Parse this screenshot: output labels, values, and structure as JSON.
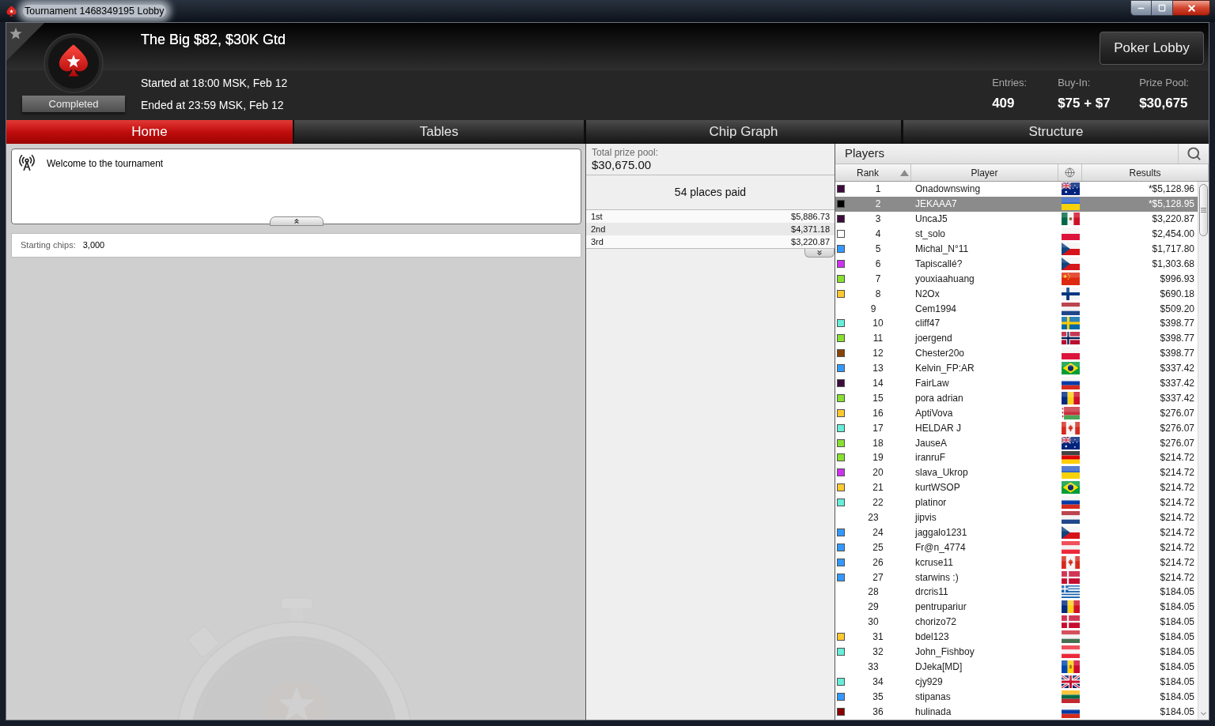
{
  "window": {
    "title": "Tournament 1468349195 Lobby"
  },
  "header": {
    "title": "The Big $82, $30K Gtd",
    "status": "Completed",
    "started": "Started at 18:00 MSK, Feb 12",
    "ended": "Ended at 23:59 MSK, Feb 12",
    "lobby_button": "Poker Lobby",
    "stats": [
      {
        "label": "Entries:",
        "value": "409"
      },
      {
        "label": "Buy-In:",
        "value": "$75 + $7"
      },
      {
        "label": "Prize Pool:",
        "value": "$30,675"
      }
    ]
  },
  "tabs": [
    {
      "label": "Home",
      "selected": true
    },
    {
      "label": "Tables",
      "selected": false
    },
    {
      "label": "Chip Graph",
      "selected": false
    },
    {
      "label": "Structure",
      "selected": false
    }
  ],
  "home": {
    "message": "Welcome to the tournament",
    "starting_chips": {
      "label": "Starting chips:",
      "value": "3,000"
    }
  },
  "prizes": {
    "total_label": "Total prize pool:",
    "total": "$30,675.00",
    "places_paid": "54 places paid",
    "rows": [
      {
        "place": "1st",
        "amount": "$5,886.73"
      },
      {
        "place": "2nd",
        "amount": "$4,371.18"
      },
      {
        "place": "3rd",
        "amount": "$3,220.87"
      }
    ]
  },
  "players": {
    "title": "Players",
    "columns": [
      {
        "kind": "text",
        "label": "Rank",
        "sorted": true
      },
      {
        "kind": "text",
        "label": "Player",
        "sorted": false
      },
      {
        "kind": "icon",
        "sorted": false
      },
      {
        "kind": "text",
        "label": "Results",
        "sorted": false
      }
    ],
    "rows": [
      {
        "rank": "1",
        "name": "Onadownswing",
        "kind": "australia",
        "result": "*$5,128.96",
        "color": "#3d0c3d",
        "selected": false
      },
      {
        "rank": "2",
        "name": "JEKAAA7",
        "kind": "ukraine",
        "result": "*$5,128.95",
        "color": "#000000",
        "selected": true
      },
      {
        "rank": "3",
        "name": "UncaJ5",
        "kind": "mexico",
        "result": "$3,220.87",
        "color": "#3d0c3d",
        "selected": false
      },
      {
        "rank": "4",
        "name": "st_solo",
        "kind": "poland",
        "result": "$2,454.00",
        "color": "#ffffff",
        "selected": false
      },
      {
        "rank": "5",
        "name": "Michal_N°11",
        "kind": "czechia",
        "result": "$1,717.80",
        "color": "#3399ff",
        "selected": false
      },
      {
        "rank": "6",
        "name": "Tapiscallé?",
        "kind": "czechia",
        "result": "$1,303.68",
        "color": "#cc33ee",
        "selected": false
      },
      {
        "rank": "7",
        "name": "youxiaahuang",
        "kind": "china",
        "result": "$996.93",
        "color": "#88e030",
        "selected": false
      },
      {
        "rank": "8",
        "name": "N2Ox",
        "kind": "finland",
        "result": "$690.18",
        "color": "#ffc82e",
        "selected": false
      },
      {
        "rank": "9",
        "name": "Cem1994",
        "kind": "netherlands",
        "result": "$509.20",
        "selected": false
      },
      {
        "rank": "10",
        "name": "cliff47",
        "kind": "sweden",
        "result": "$398.77",
        "color": "#66eed8",
        "selected": false
      },
      {
        "rank": "11",
        "name": "joergend",
        "kind": "norway",
        "result": "$398.77",
        "color": "#88e030",
        "selected": false
      },
      {
        "rank": "12",
        "name": "Chester20o",
        "kind": "poland",
        "result": "$398.77",
        "color": "#884408",
        "selected": false
      },
      {
        "rank": "13",
        "name": "Kelvin_FP:AR",
        "kind": "brazil",
        "result": "$337.42",
        "color": "#3399ff",
        "selected": false
      },
      {
        "rank": "14",
        "name": "FairLaw",
        "kind": "russia",
        "result": "$337.42",
        "color": "#3d0c3d",
        "selected": false
      },
      {
        "rank": "15",
        "name": "pora adrian",
        "kind": "romania",
        "result": "$337.42",
        "color": "#88e030",
        "selected": false
      },
      {
        "rank": "16",
        "name": "AptiVova",
        "kind": "belarus",
        "result": "$276.07",
        "color": "#ffc82e",
        "selected": false
      },
      {
        "rank": "17",
        "name": "HELDAR J",
        "kind": "canada",
        "result": "$276.07",
        "color": "#66eed8",
        "selected": false
      },
      {
        "rank": "18",
        "name": "JauseA",
        "kind": "australia",
        "result": "$276.07",
        "color": "#88e030",
        "selected": false
      },
      {
        "rank": "19",
        "name": "iranruF",
        "kind": "germany",
        "result": "$214.72",
        "color": "#88e030",
        "selected": false
      },
      {
        "rank": "20",
        "name": "slava_Ukrop",
        "kind": "ukraine",
        "result": "$214.72",
        "color": "#cc33ee",
        "selected": false
      },
      {
        "rank": "21",
        "name": "kurtWSOP",
        "kind": "brazil",
        "result": "$214.72",
        "color": "#ffc82e",
        "selected": false
      },
      {
        "rank": "22",
        "name": "platinor",
        "kind": "russia",
        "result": "$214.72",
        "color": "#66eed8",
        "selected": false
      },
      {
        "rank": "23",
        "name": "jipvis",
        "kind": "netherlands",
        "result": "$214.72",
        "selected": false
      },
      {
        "rank": "24",
        "name": "jaggalo1231",
        "kind": "czechia",
        "result": "$214.72",
        "color": "#3399ff",
        "selected": false
      },
      {
        "rank": "25",
        "name": "Fr@n_4774",
        "kind": "austria",
        "result": "$214.72",
        "color": "#3399ff",
        "selected": false
      },
      {
        "rank": "26",
        "name": "kcruse11",
        "kind": "canada",
        "result": "$214.72",
        "color": "#3399ff",
        "selected": false
      },
      {
        "rank": "27",
        "name": "starwins :)",
        "kind": "denmark",
        "result": "$214.72",
        "color": "#3399ff",
        "selected": false
      },
      {
        "rank": "28",
        "name": "drcris11",
        "kind": "greece",
        "result": "$184.05",
        "selected": false
      },
      {
        "rank": "29",
        "name": "pentrupariur",
        "kind": "romania",
        "result": "$184.05",
        "selected": false
      },
      {
        "rank": "30",
        "name": "chorizo72",
        "kind": "denmark",
        "result": "$184.05",
        "selected": false
      },
      {
        "rank": "31",
        "name": "bdel123",
        "kind": "hungary",
        "result": "$184.05",
        "color": "#ffc82e",
        "selected": false
      },
      {
        "rank": "32",
        "name": "John_Fishboy",
        "kind": "austria",
        "result": "$184.05",
        "color": "#66eed8",
        "selected": false
      },
      {
        "rank": "33",
        "name": "DJeka[MD]",
        "kind": "moldova",
        "result": "$184.05",
        "selected": false
      },
      {
        "rank": "34",
        "name": "cjy929",
        "kind": "uk",
        "result": "$184.05",
        "color": "#66eed8",
        "selected": false
      },
      {
        "rank": "35",
        "name": "stipanas",
        "kind": "lithuania",
        "result": "$184.05",
        "color": "#3399ff",
        "selected": false
      },
      {
        "rank": "36",
        "name": "hulinada",
        "kind": "russia",
        "result": "$184.05",
        "color": "#880000",
        "selected": false
      }
    ]
  }
}
